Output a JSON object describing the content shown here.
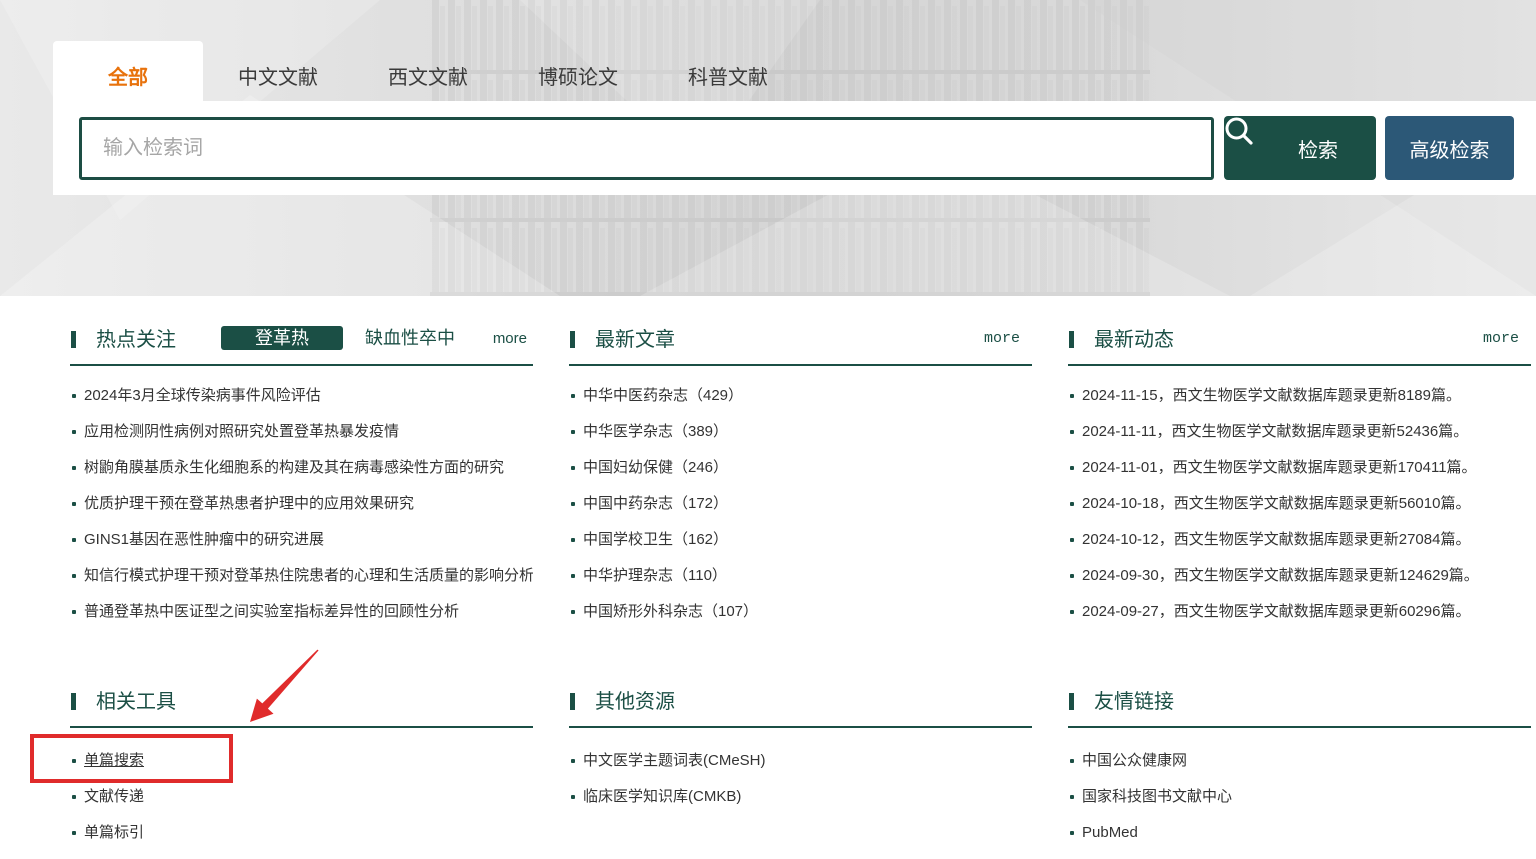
{
  "search": {
    "tabs": [
      {
        "label": "全部",
        "active": true
      },
      {
        "label": "中文文献",
        "active": false
      },
      {
        "label": "西文文献",
        "active": false
      },
      {
        "label": "博硕论文",
        "active": false
      },
      {
        "label": "科普文献",
        "active": false
      }
    ],
    "value": "",
    "placeholder": "输入检索词",
    "search_button": {
      "label": "检索",
      "icon": "search-icon"
    },
    "advanced_button": {
      "label": "高级检索"
    }
  },
  "hot_topics": {
    "title": "热点关注",
    "tags": [
      {
        "label": "登革热",
        "active": true
      },
      {
        "label": "缺血性卒中",
        "active": false
      }
    ],
    "more": "more",
    "items": [
      "2024年3月全球传染病事件风险评估",
      "应用检测阴性病例对照研究处置登革热暴发疫情",
      "树鼩角膜基质永生化细胞系的构建及其在病毒感染性方面的研究",
      "优质护理干预在登革热患者护理中的应用效果研究",
      "GINS1基因在恶性肿瘤中的研究进展",
      "知信行模式护理干预对登革热住院患者的心理和生活质量的影响分析",
      "普通登革热中医证型之间实验室指标差异性的回顾性分析"
    ]
  },
  "latest_articles": {
    "title": "最新文章",
    "more": "more",
    "items": [
      "中华中医药杂志（429）",
      "中华医学杂志（389）",
      "中国妇幼保健（246）",
      "中国中药杂志（172）",
      "中国学校卫生（162）",
      "中华护理杂志（110）",
      "中国矫形外科杂志（107）"
    ]
  },
  "latest_updates": {
    "title": "最新动态",
    "more": "more",
    "items": [
      "2024-11-15，西文生物医学文献数据库题录更新8189篇。",
      "2024-11-11，西文生物医学文献数据库题录更新52436篇。",
      "2024-11-01，西文生物医学文献数据库题录更新170411篇。",
      "2024-10-18，西文生物医学文献数据库题录更新56010篇。",
      "2024-10-12，西文生物医学文献数据库题录更新27084篇。",
      "2024-09-30，西文生物医学文献数据库题录更新124629篇。",
      "2024-09-27，西文生物医学文献数据库题录更新60296篇。"
    ]
  },
  "related_tools": {
    "title": "相关工具",
    "items": [
      "单篇搜索",
      "文献传递",
      "单篇标引"
    ]
  },
  "other_resources": {
    "title": "其他资源",
    "items": [
      "中文医学主题词表(CMeSH)",
      "临床医学知识库(CMKB)"
    ]
  },
  "friendly_links": {
    "title": "友情链接",
    "items": [
      "中国公众健康网",
      "国家科技图书文献中心",
      "PubMed"
    ]
  },
  "colors": {
    "active_tab": "#e8720c",
    "primary": "#1b4f45",
    "advanced_button": "#2c5877",
    "annotation": "#e02b2b"
  }
}
